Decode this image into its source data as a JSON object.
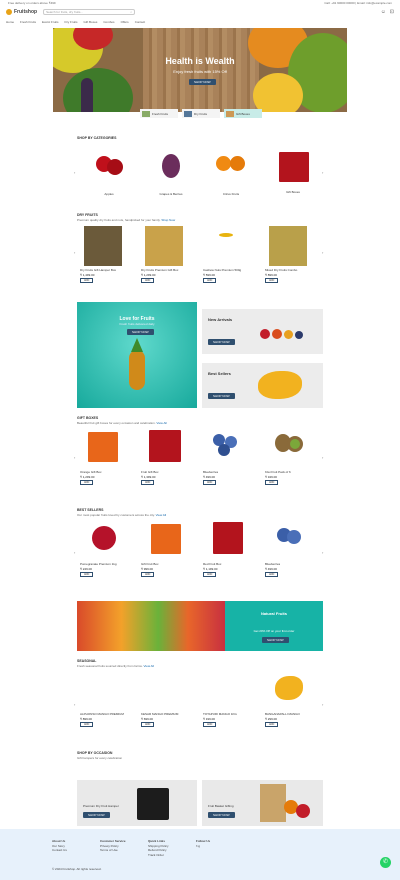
{
  "topbar": {
    "left": "Free delivery on orders above ₹499",
    "right": "Call: +91 90000 00000   |   Email: info@example.com"
  },
  "header": {
    "logo": "Fruitshop",
    "search_placeholder": "Search for fruits, dry fruits...",
    "icons": [
      "user-icon",
      "cart-icon"
    ]
  },
  "nav": {
    "items": [
      "Home",
      "Fresh Fruits",
      "Exotic Fruits",
      "Dry Fruits",
      "Gift Boxes",
      "Combos",
      "Offers",
      "Contact"
    ]
  },
  "hero": {
    "title": "Health is Wealth",
    "subtitle": "Enjoy fresh fruits with 15% Off",
    "button": "SHOP NOW"
  },
  "chips": [
    {
      "label": "Fresh Fruits"
    },
    {
      "label": "Dry Fruits"
    },
    {
      "label": "Gift Boxes"
    }
  ],
  "sections": {
    "categories": {
      "title": "SHOP BY CATEGORIES",
      "items": [
        "Apples",
        "Grapes & Berries",
        "Citrus Fruits",
        "Gift Boxes"
      ]
    },
    "dry": {
      "title": "DRY FRUITS",
      "sub": "Premium quality dry fruits and nuts, handpicked for your family.",
      "link": "Shop Now",
      "items": [
        {
          "t": "Dry Fruits Gift Hamper Box",
          "p": "₹ 1,499.00"
        },
        {
          "t": "Dry Fruits Premium Gift Box",
          "p": "₹ 1,299.00"
        },
        {
          "t": "Cashew Nuts Premium 500g",
          "p": "₹ 599.00"
        },
        {
          "t": "Mixed Dry Fruits Combo",
          "p": "₹ 899.00"
        }
      ]
    },
    "banners": {
      "big_title": "Love for Fruits",
      "big_sub": "Fresh fruits delivered daily",
      "big_btn": "SHOP NOW",
      "s1_title": "New Arrivals",
      "s1_btn": "SHOP NOW",
      "s2_title": "Best Sellers",
      "s2_btn": "SHOP NOW"
    },
    "gift": {
      "title": "GIFT BOXES",
      "sub": "Beautiful fruit gift boxes for every occasion and celebration.",
      "link": "View All",
      "items": [
        {
          "t": "Orange Gift Box",
          "p": "₹ 1,299.00"
        },
        {
          "t": "Fruit Gift Box",
          "p": "₹ 1,399.00"
        },
        {
          "t": "Blueberries",
          "p": "₹ 499.00"
        },
        {
          "t": "Kiwi Fruit Pack of 6",
          "p": "₹ 349.00"
        }
      ]
    },
    "best": {
      "title": "BEST SELLERS",
      "sub": "Our most popular fruits loved by customers across the city.",
      "link": "View All",
      "items": [
        {
          "t": "Pomegranate Premium 1kg",
          "p": "₹ 249.00"
        },
        {
          "t": "Gift Fruit Box",
          "p": "₹ 999.00"
        },
        {
          "t": "Red Fruit Box",
          "p": "₹ 1,199.00"
        },
        {
          "t": "Blueberries",
          "p": "₹ 499.00"
        }
      ]
    },
    "wide": {
      "title": "Natural Fruits",
      "sub": "Get 20% Off on your first order",
      "btn": "SHOP NOW"
    },
    "seasonal": {
      "title": "SEASONAL",
      "sub": "Fresh seasonal fruits sourced directly from farms.",
      "link": "View All",
      "items": [
        {
          "t": "ALPHONSO MANGO PREMIUM",
          "p": "₹ 899.00"
        },
        {
          "t": "KESAR MANGO PREMIUM",
          "p": "₹ 699.00"
        },
        {
          "t": "TOTAPURI MANGO 1KG",
          "p": "₹ 199.00"
        },
        {
          "t": "BANGANAPALLI MANGO",
          "p": "₹ 299.00"
        }
      ]
    },
    "brands": {
      "title": "SHOP BY OCCASION",
      "sub": "Gift hampers for every celebration"
    },
    "bottom": {
      "b1": "Premium Dry Fruit Hamper",
      "b1_btn": "SHOP NOW",
      "b2": "Fruit Basket Gifting",
      "b2_btn": "SHOP NOW"
    }
  },
  "add_label": "ADD",
  "footer": {
    "c1": {
      "h": "About Us",
      "l": [
        "Our Story",
        "Contact Us"
      ]
    },
    "c2": {
      "h": "Customer Service",
      "l": [
        "Privacy Policy",
        "Terms of Use"
      ]
    },
    "c3": {
      "h": "Quick Links",
      "l": [
        "Shipping Policy",
        "Refund Policy",
        "Track Order"
      ]
    },
    "c4": {
      "h": "Follow Us",
      "l": [
        "f  ig"
      ]
    },
    "copy": "© 2024 Fruitshop. All rights reserved."
  },
  "colors": {
    "accent": "#2f4f6f",
    "teal": "#17b3a6",
    "gift": "#b3141d"
  }
}
